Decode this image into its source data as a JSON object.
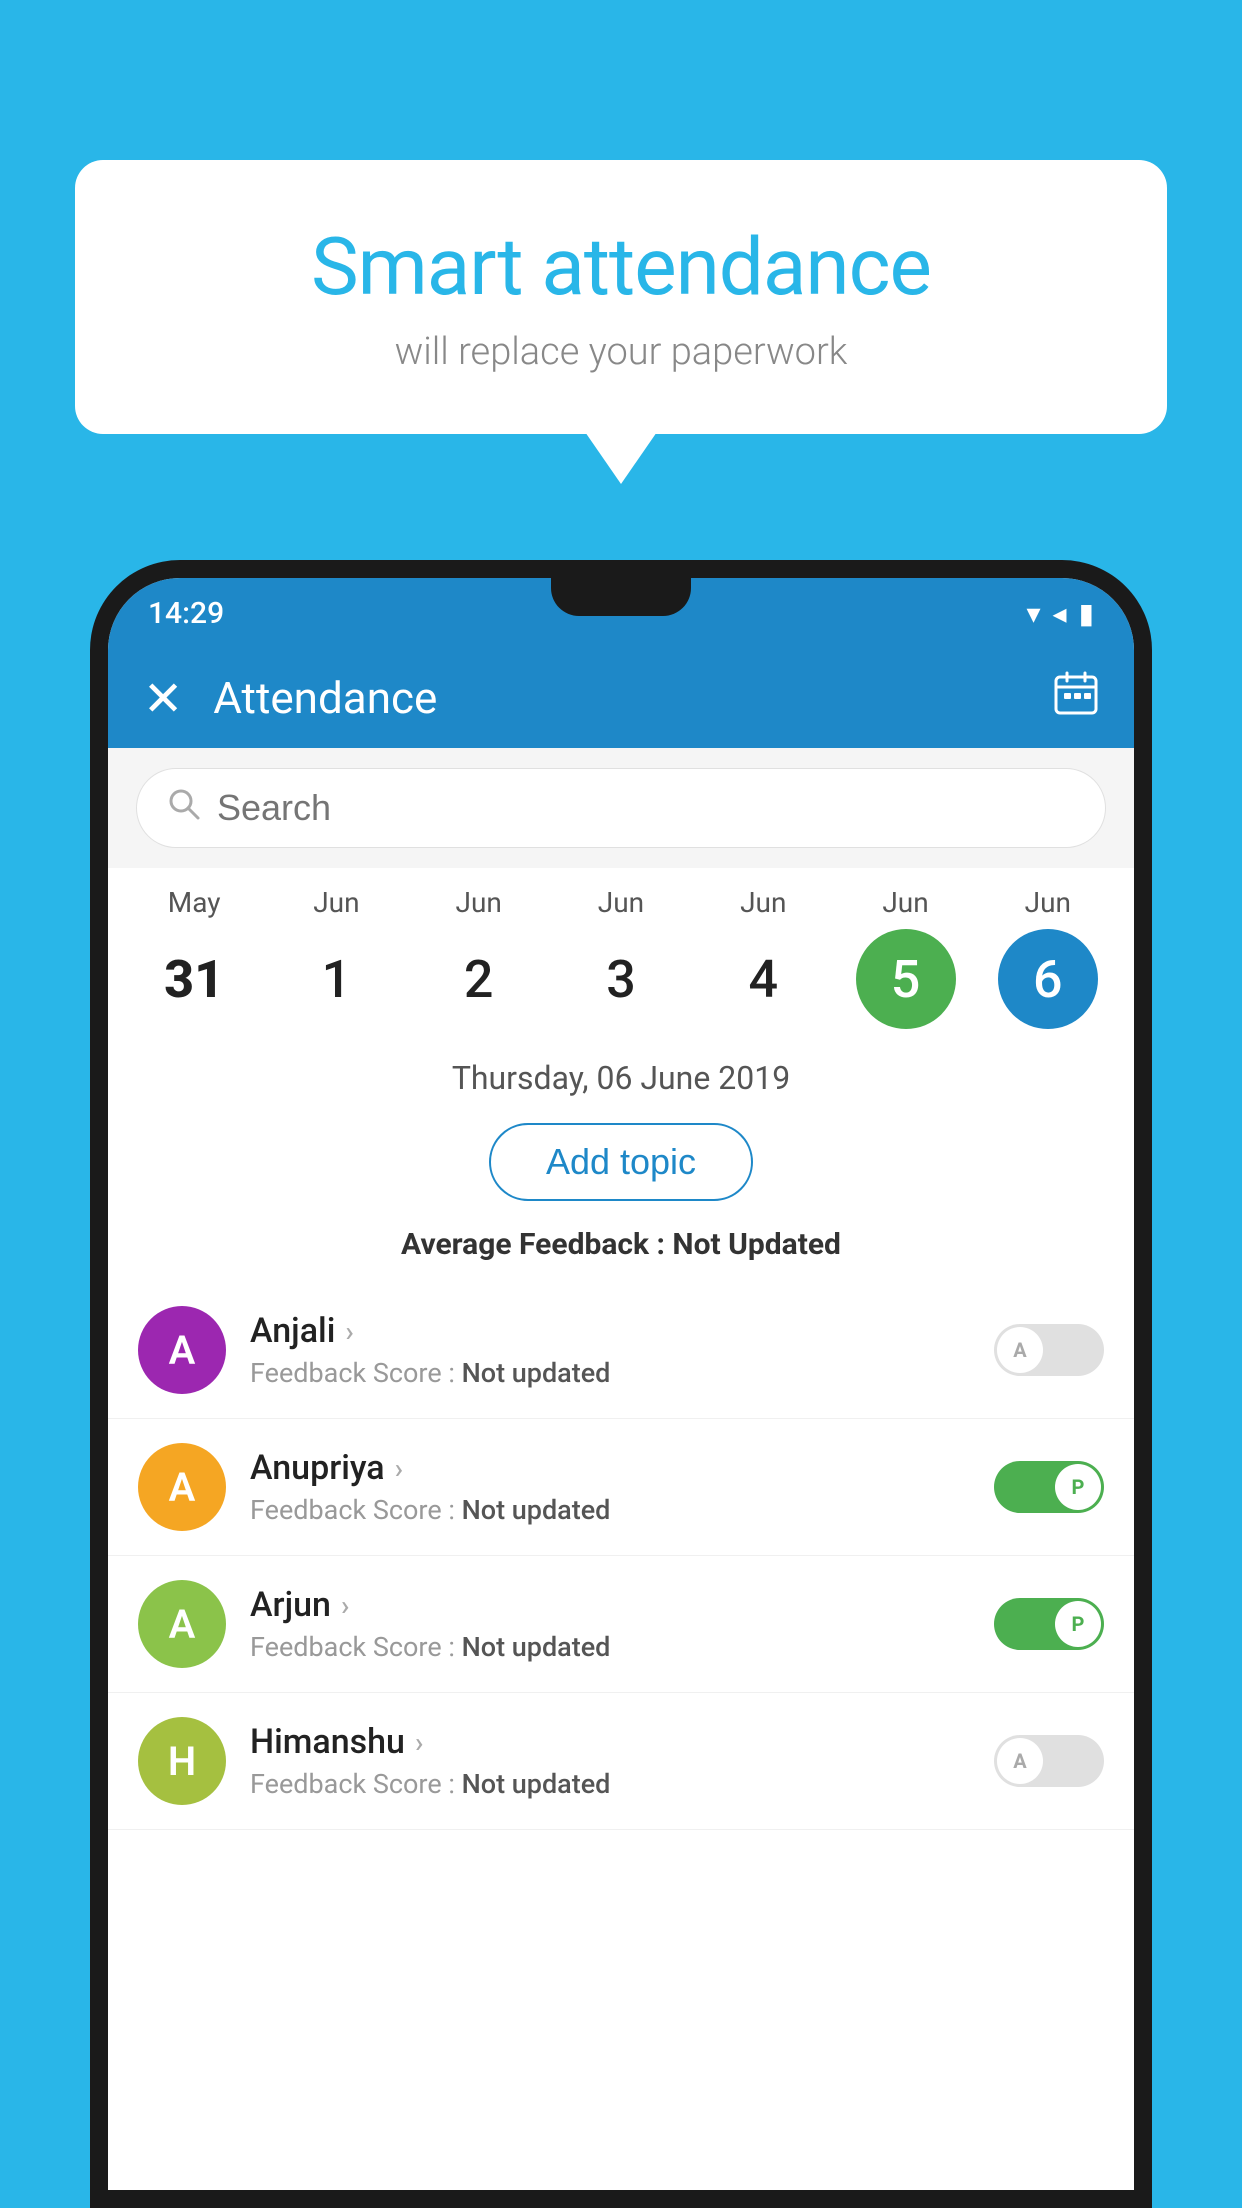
{
  "background_color": "#29b6e8",
  "speech_bubble": {
    "title": "Smart attendance",
    "subtitle": "will replace your paperwork"
  },
  "status_bar": {
    "time": "14:29",
    "wifi_icon": "▼",
    "signal_icon": "◀",
    "battery_icon": "▮"
  },
  "app_bar": {
    "close_icon": "✕",
    "title": "Attendance",
    "calendar_icon": "📅"
  },
  "search": {
    "placeholder": "Search"
  },
  "calendar": {
    "days": [
      {
        "month": "May",
        "day": "31",
        "style": "bold"
      },
      {
        "month": "Jun",
        "day": "1",
        "style": "normal"
      },
      {
        "month": "Jun",
        "day": "2",
        "style": "normal"
      },
      {
        "month": "Jun",
        "day": "3",
        "style": "normal"
      },
      {
        "month": "Jun",
        "day": "4",
        "style": "normal"
      },
      {
        "month": "Jun",
        "day": "5",
        "style": "today"
      },
      {
        "month": "Jun",
        "day": "6",
        "style": "selected"
      }
    ]
  },
  "selected_date": "Thursday, 06 June 2019",
  "add_topic_label": "Add topic",
  "average_feedback": {
    "label": "Average Feedback : ",
    "value": "Not Updated"
  },
  "students": [
    {
      "name": "Anjali",
      "avatar_letter": "A",
      "avatar_color": "purple",
      "feedback": "Feedback Score : ",
      "feedback_value": "Not updated",
      "toggle": "off",
      "toggle_letter": "A"
    },
    {
      "name": "Anupriya",
      "avatar_letter": "A",
      "avatar_color": "yellow",
      "feedback": "Feedback Score : ",
      "feedback_value": "Not updated",
      "toggle": "on",
      "toggle_letter": "P"
    },
    {
      "name": "Arjun",
      "avatar_letter": "A",
      "avatar_color": "light-green",
      "feedback": "Feedback Score : ",
      "feedback_value": "Not updated",
      "toggle": "on",
      "toggle_letter": "P"
    },
    {
      "name": "Himanshu",
      "avatar_letter": "H",
      "avatar_color": "olive",
      "feedback": "Feedback Score : ",
      "feedback_value": "Not updated",
      "toggle": "off",
      "toggle_letter": "A"
    }
  ]
}
